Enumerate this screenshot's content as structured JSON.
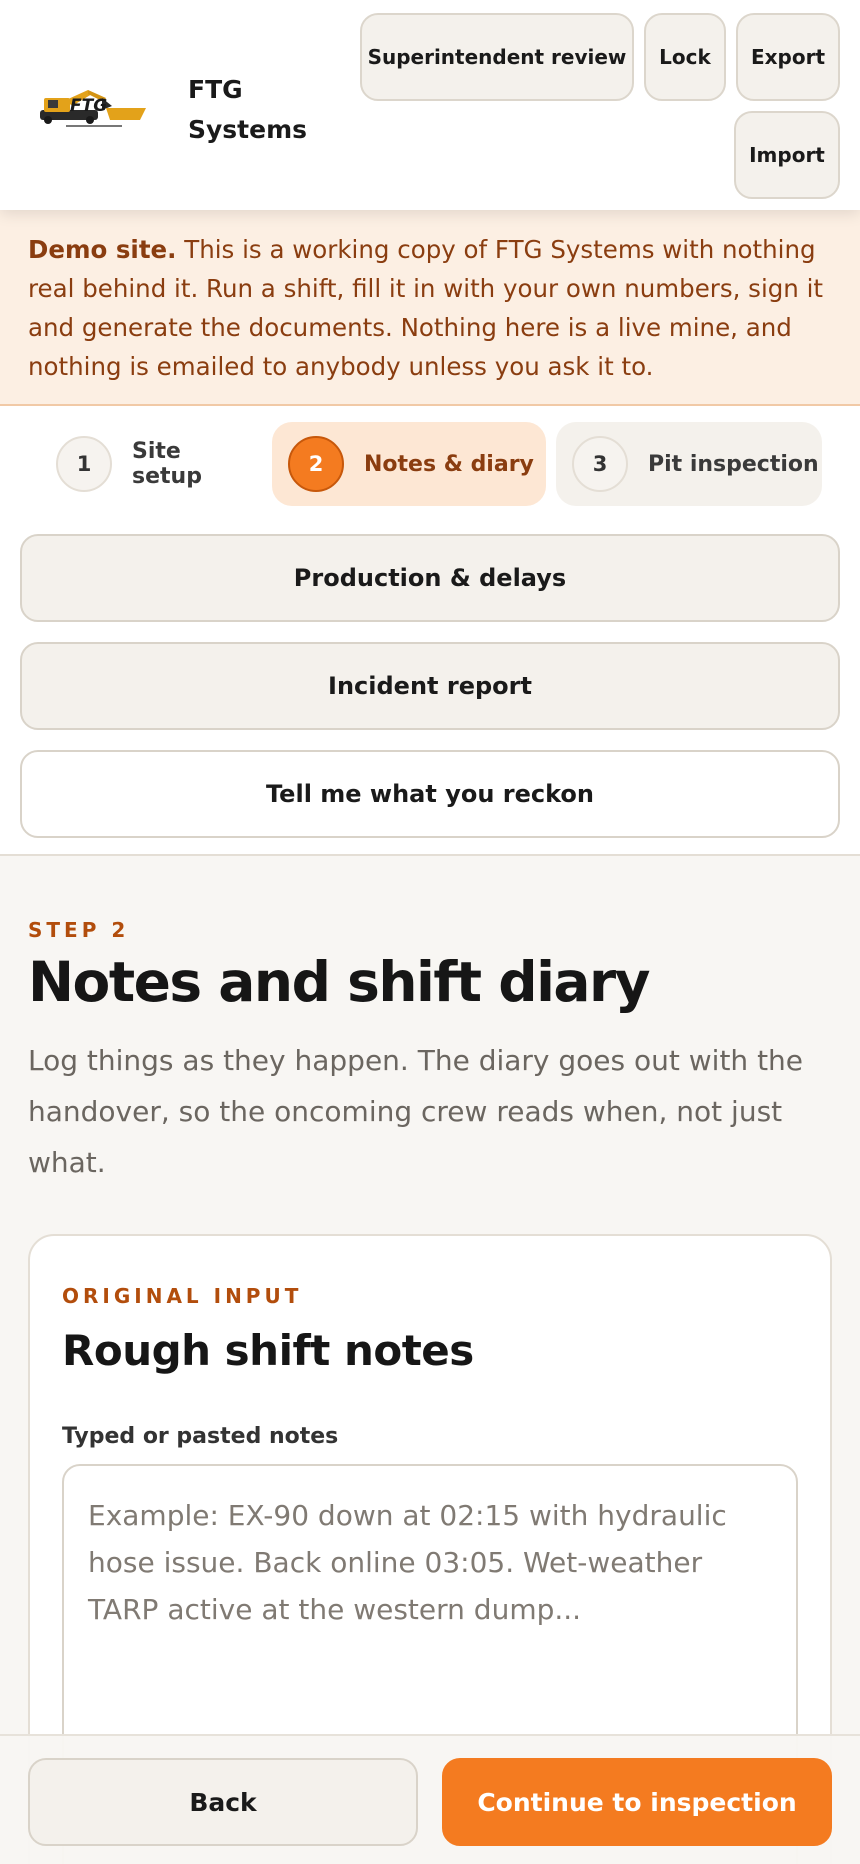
{
  "app": {
    "brand_name": "FTG Systems",
    "logo_text": "FTG",
    "accent_color": "#f47b20"
  },
  "header": {
    "buttons": {
      "review": "Superintendent review",
      "lock": "Lock",
      "export": "Export",
      "import": "Import"
    }
  },
  "banner": {
    "bold": "Demo site.",
    "text": " This is a working copy of FTG Systems with nothing real behind it. Run a shift, fill it in with your own numbers, sign it and generate the documents. Nothing here is a live mine, and nothing is emailed to anybody unless you ask it to."
  },
  "steps": [
    {
      "number": "1",
      "label": "Site setup",
      "state": "default"
    },
    {
      "number": "2",
      "label": "Notes & diary",
      "state": "active"
    },
    {
      "number": "3",
      "label": "Pit inspection",
      "state": "default"
    }
  ],
  "sections": {
    "production": "Production & delays",
    "incident": "Incident report",
    "reckon": "Tell me what you reckon"
  },
  "main": {
    "eyebrow": "STEP 2",
    "title": "Notes and shift diary",
    "lead": "Log things as they happen. The diary goes out with the handover, so the oncoming crew reads when, not just what."
  },
  "card": {
    "eyebrow": "ORIGINAL INPUT",
    "title": "Rough shift notes",
    "field_label": "Typed or pasted notes",
    "field_value": "",
    "field_placeholder": "Example: EX-90 down at 02:15 with hydraulic hose issue. Back online 03:05. Wet-weather TARP active at the western dump..."
  },
  "footer": {
    "back": "Back",
    "continue": "Continue to inspection"
  }
}
